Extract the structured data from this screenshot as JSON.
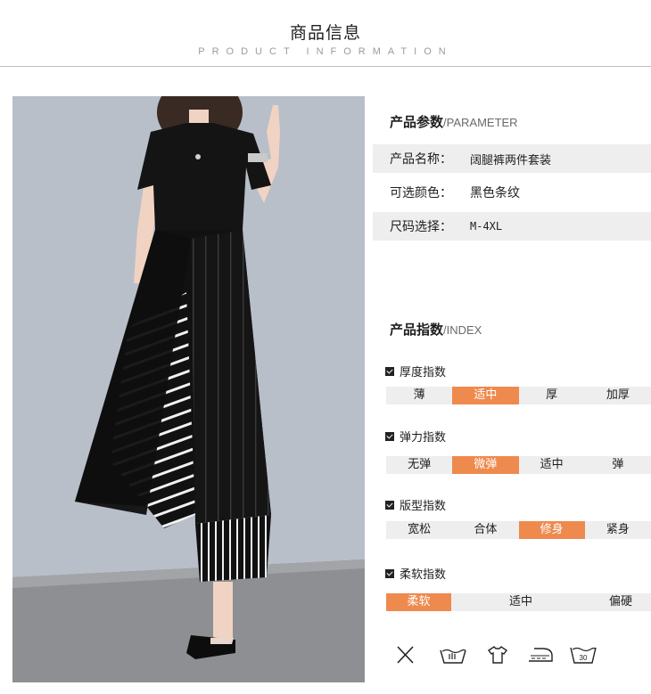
{
  "header": {
    "title": "商品信息",
    "subtitle": "PRODUCT INFORMATION"
  },
  "parameter": {
    "title": "产品参数",
    "title_en": "/PARAMETER",
    "rows": [
      {
        "key": "产品名称：",
        "value": "阔腿裤两件套装"
      },
      {
        "key": "可选颜色：",
        "value": "黑色条纹"
      },
      {
        "key": "尺码选择：",
        "value": "M-4XL"
      }
    ]
  },
  "index": {
    "title": "产品指数",
    "title_en": "/INDEX",
    "groups": [
      {
        "label": "厚度指数",
        "options": [
          "薄",
          "适中",
          "厚",
          "加厚"
        ],
        "selected": 1
      },
      {
        "label": "弹力指数",
        "options": [
          "无弹",
          "微弹",
          "适中",
          "弹"
        ],
        "selected": 1
      },
      {
        "label": "版型指数",
        "options": [
          "宽松",
          "合体",
          "修身",
          "紧身"
        ],
        "selected": 2
      },
      {
        "label": "柔软指数",
        "options": [
          "柔软",
          "适中",
          "偏硬"
        ],
        "selected": 0
      }
    ]
  },
  "care_icons": [
    {
      "icon": "no-dry-clean-icon"
    },
    {
      "icon": "hand-wash-icon"
    },
    {
      "icon": "hang-dry-icon"
    },
    {
      "icon": "iron-icon"
    },
    {
      "icon": "wash-30-icon",
      "label": "30"
    }
  ],
  "colors": {
    "accent": "#ee8a4e",
    "row_bg": "#eeeeee"
  }
}
